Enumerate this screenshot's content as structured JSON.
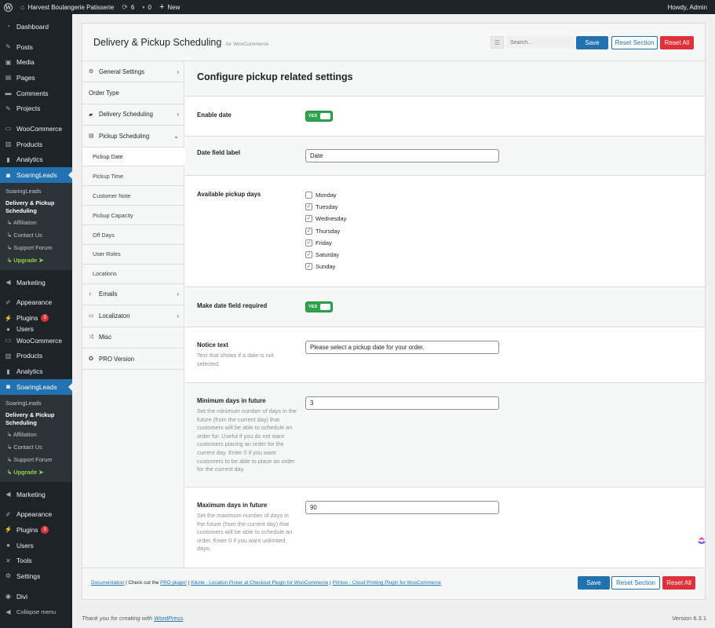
{
  "adminbar": {
    "site_name": "Harvest Boulangerie Patisserie",
    "updates_count": "6",
    "comments_count": "0",
    "new_label": "New",
    "greeting": "Howdy, Admin"
  },
  "sidebar": {
    "items_top": [
      {
        "label": "Dashboard",
        "icon": "dashboard-icon"
      },
      {
        "label": "Posts",
        "icon": "pin-icon"
      },
      {
        "label": "Media",
        "icon": "media-icon"
      },
      {
        "label": "Pages",
        "icon": "page-icon"
      },
      {
        "label": "Comments",
        "icon": "comment-icon"
      },
      {
        "label": "Projects",
        "icon": "pin-icon"
      },
      {
        "label": "WooCommerce",
        "icon": "woo-icon"
      },
      {
        "label": "Products",
        "icon": "archive-icon"
      },
      {
        "label": "Analytics",
        "icon": "chart-icon"
      },
      {
        "label": "SoaringLeads",
        "icon": "chat-icon"
      }
    ],
    "submenu": {
      "title": "SoaringLeads",
      "current": "Delivery & Pickup Scheduling",
      "affiliation": "↳ Affiliation",
      "contact": "↳ Contact Us",
      "support": "↳ Support Forum",
      "upgrade": "↳ Upgrade ➤"
    },
    "items_mid": [
      {
        "label": "Marketing",
        "icon": "megaphone-icon"
      },
      {
        "label": "Appearance",
        "icon": "brush-icon"
      },
      {
        "label": "Plugins",
        "icon": "plugin-icon",
        "count": "5"
      },
      {
        "label": "Users",
        "icon": "users-icon"
      },
      {
        "label": "WooCommerce",
        "icon": "woo-icon"
      },
      {
        "label": "Products",
        "icon": "archive-icon"
      },
      {
        "label": "Analytics",
        "icon": "chart-icon"
      },
      {
        "label": "SoaringLeads",
        "icon": "chat-icon"
      }
    ],
    "items_bottom": [
      {
        "label": "Marketing",
        "icon": "megaphone-icon"
      },
      {
        "label": "Appearance",
        "icon": "brush-icon"
      },
      {
        "label": "Plugins",
        "icon": "plugin-icon",
        "count": "5"
      },
      {
        "label": "Users",
        "icon": "users-icon"
      },
      {
        "label": "Tools",
        "icon": "wrench-icon"
      },
      {
        "label": "Settings",
        "icon": "settings-icon"
      },
      {
        "label": "Divi",
        "icon": "divi-icon"
      },
      {
        "label": "Collapse menu",
        "icon": "collapse-icon"
      }
    ]
  },
  "header": {
    "title": "Delivery & Pickup Scheduling",
    "subtitle": "for WooCommerce",
    "search_placeholder": "Search...",
    "save_label": "Save",
    "reset_section_label": "Reset Section",
    "reset_all_label": "Reset All"
  },
  "nav": {
    "general": "General Settings",
    "order_type": "Order Type",
    "delivery": "Delivery Scheduling",
    "pickup": "Pickup Scheduling",
    "pickup_sub": [
      "Pickup Date",
      "Pickup Time",
      "Customer Note",
      "Pickup Capacity",
      "Off Days",
      "User Roles",
      "Locations"
    ],
    "emails": "Emails",
    "localization": "Localizaton",
    "misc": "Misc",
    "pro": "PRO Version"
  },
  "section": {
    "title": "Configure pickup related settings",
    "enable_date": {
      "label": "Enable date",
      "toggle": "YES"
    },
    "date_label": {
      "label": "Date field label",
      "value": "Date"
    },
    "pickup_days": {
      "label": "Available pickup days",
      "days": [
        {
          "name": "Monday",
          "checked": false
        },
        {
          "name": "Tuesday",
          "checked": true
        },
        {
          "name": "Wednesday",
          "checked": true
        },
        {
          "name": "Thursday",
          "checked": true
        },
        {
          "name": "Friday",
          "checked": true
        },
        {
          "name": "Saturday",
          "checked": true
        },
        {
          "name": "Sunday",
          "checked": true
        }
      ]
    },
    "required": {
      "label": "Make date field required",
      "toggle": "YES"
    },
    "notice": {
      "label": "Notice text",
      "desc": "Text that shows if a date is not selected.",
      "value": "Please select a pickup date for your order."
    },
    "min_days": {
      "label": "Minimum days in future",
      "desc": "Set the minimum number of days in the future (from the current day) that customers will be able to schedule an order for. Useful if you do not want customers placing an order for the current day. Enter 0 if you want customers to be able to place an order for the current day.",
      "value": "3"
    },
    "max_days": {
      "label": "Maximum days in future",
      "desc": "Set the maximum number of days in the future (from the current day) that customers will be able to schedule an order. Enter 0 if you want unlimited days.",
      "value": "90"
    }
  },
  "footer": {
    "documentation": "Documentation",
    "sep1": " | Check out the ",
    "pro_plugin": "PRO plugin!",
    "sep2": " | ",
    "kikote": "Kikote - Location Picker at Checkout Plugin for WooCommerce",
    "sep3": " | ",
    "printus": "Printus - Cloud Printing Plugin for WooCommerce",
    "save_label": "Save",
    "reset_section_label": "Reset Section",
    "reset_all_label": "Reset All"
  },
  "bottom": {
    "thanks_prefix": "Thank you for creating with ",
    "wordpress": "WordPress",
    "thanks_suffix": ".",
    "version": "Version 6.3.1"
  },
  "colors": {
    "accent": "#2271b1",
    "danger": "#e0303a",
    "toggle_on": "#2ea44f",
    "sidebar_bg": "#1d2327",
    "upgrade": "#8fd14f"
  }
}
